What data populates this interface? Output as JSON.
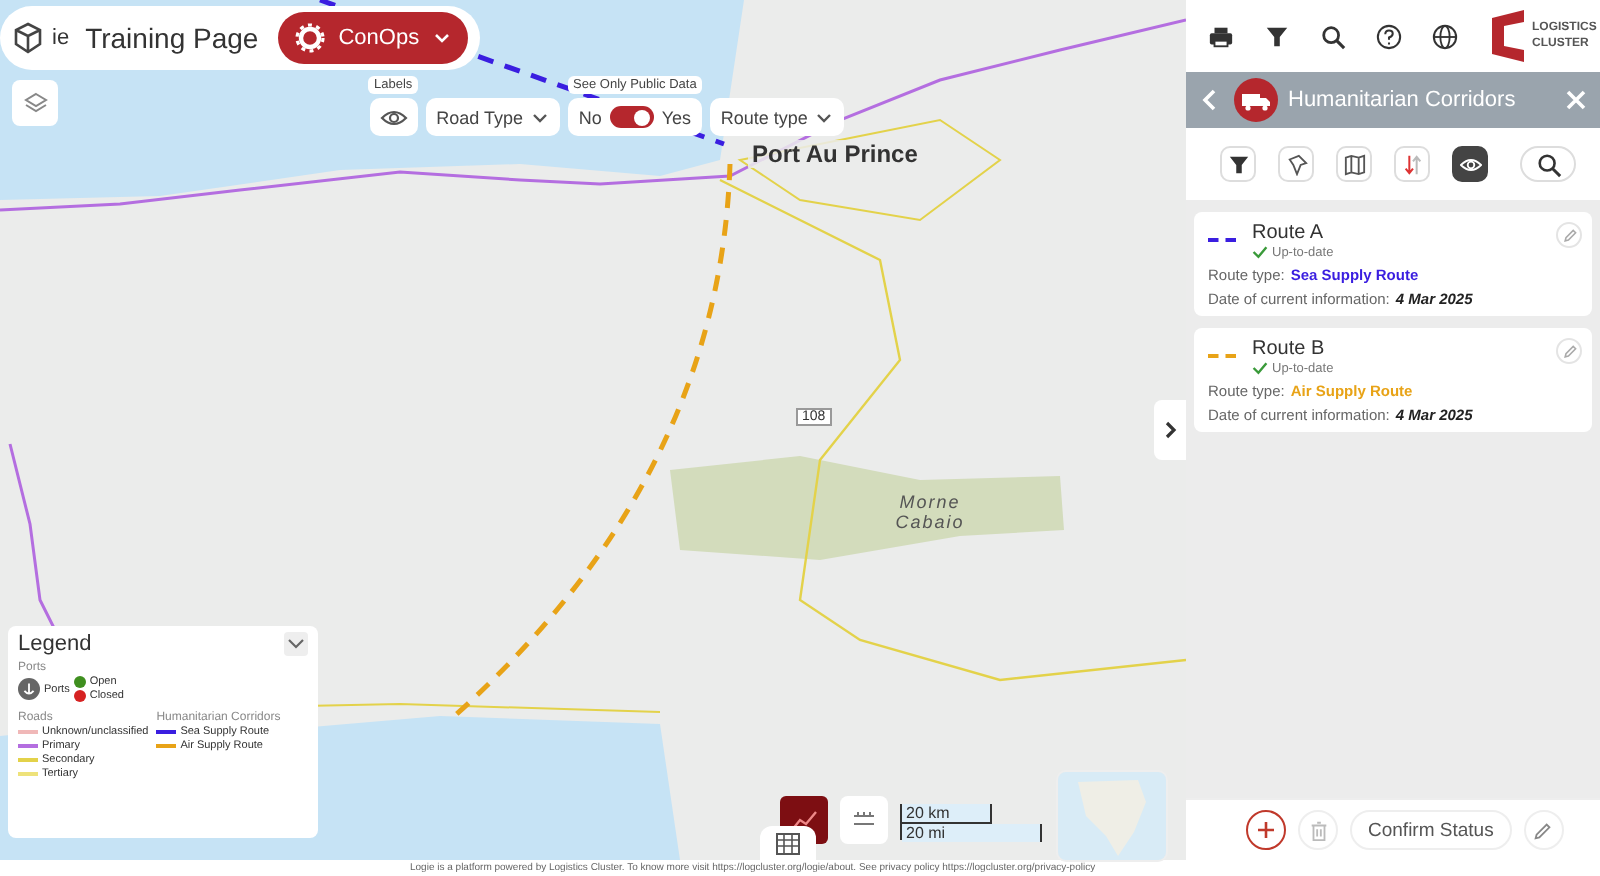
{
  "header": {
    "logo_text": "ie",
    "title": "Training Page",
    "mode_button": "ConOps"
  },
  "filters": {
    "labels_caption": "Labels",
    "road_type": "Road Type",
    "public_data": {
      "caption": "See Only Public Data",
      "off_label": "No",
      "on_label": "Yes",
      "on": true
    },
    "route_type": "Route type"
  },
  "map_labels": [
    {
      "text": "Port Au Prince",
      "kind": "city"
    },
    {
      "text": "Morne Cabaio",
      "kind": "mountain"
    },
    {
      "text": "108",
      "kind": "shield"
    }
  ],
  "logo": {
    "line1": "LOGISTICS",
    "line2": "CLUSTER"
  },
  "panel": {
    "title": "Humanitarian Corridors",
    "tools": [
      {
        "kind": "filter",
        "selected": false
      },
      {
        "kind": "pin",
        "selected": false
      },
      {
        "kind": "map",
        "selected": false
      },
      {
        "kind": "sort",
        "selected": false
      },
      {
        "kind": "eye",
        "selected": true
      }
    ],
    "routes": [
      {
        "name": "Route A",
        "status": "Up-to-date",
        "type_label": "Route type:",
        "type_value": "Sea Supply Route",
        "color": "#3a1ee0",
        "date_label": "Date of current information:",
        "date_value": "4 Mar 2025"
      },
      {
        "name": "Route B",
        "status": "Up-to-date",
        "type_label": "Route type:",
        "type_value": "Air Supply Route",
        "color": "#e8a317",
        "date_label": "Date of current information:",
        "date_value": "4 Mar 2025"
      }
    ],
    "confirm_button": "Confirm Status"
  },
  "legend": {
    "title": "Legend",
    "ports_heading": "Ports",
    "ports_label": "Ports",
    "port_states": [
      {
        "label": "Open",
        "color": "#3f8f1f"
      },
      {
        "label": "Closed",
        "color": "#d62222"
      }
    ],
    "roads_heading": "Roads",
    "roads": [
      {
        "label": "Unknown/unclassified",
        "color": "#f0b8b8"
      },
      {
        "label": "Primary",
        "color": "#b46ee0"
      },
      {
        "label": "Secondary",
        "color": "#e3d24a"
      },
      {
        "label": "Tertiary",
        "color": "#eee27a"
      }
    ],
    "corridors_heading": "Humanitarian Corridors",
    "corridors": [
      {
        "label": "Sea Supply Route",
        "color": "#3a1ee0"
      },
      {
        "label": "Air Supply Route",
        "color": "#e8a317"
      }
    ]
  },
  "scale": {
    "km": "20 km",
    "mi": "20 mi"
  },
  "footer": "Logie is a platform powered by Logistics Cluster. To know more visit https://logcluster.org/logie/about. See privacy policy https://logcluster.org/privacy-policy"
}
